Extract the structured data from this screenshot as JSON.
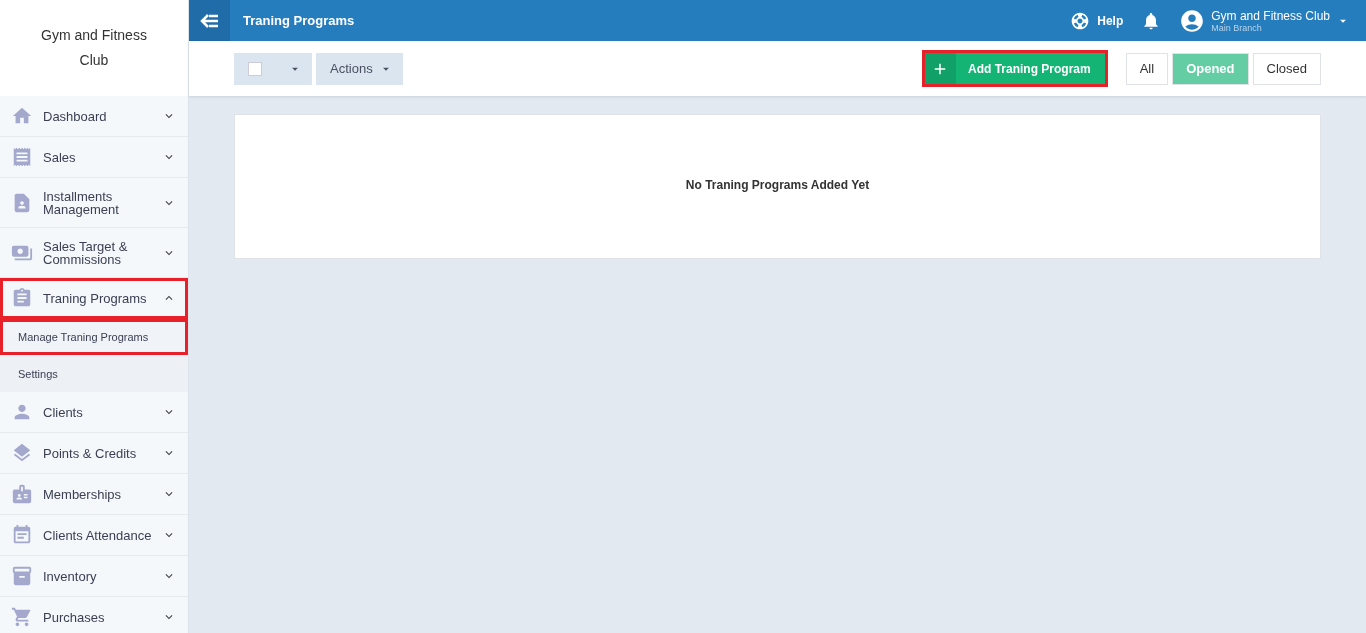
{
  "sidebar": {
    "brand": "Gym and Fitness Club",
    "items": [
      {
        "label": "Dashboard",
        "expanded": false
      },
      {
        "label": "Sales",
        "expanded": false
      },
      {
        "label": "Installments Management",
        "expanded": false
      },
      {
        "label": "Sales Target & Commissions",
        "expanded": false
      },
      {
        "label": "Traning Programs",
        "expanded": true,
        "highlighted": true,
        "children": [
          {
            "label": "Manage Traning Programs",
            "selected": true,
            "highlighted": true
          },
          {
            "label": "Settings",
            "selected": false,
            "highlighted": false
          }
        ]
      },
      {
        "label": "Clients",
        "expanded": false
      },
      {
        "label": "Points & Credits",
        "expanded": false
      },
      {
        "label": "Memberships",
        "expanded": false
      },
      {
        "label": "Clients Attendance",
        "expanded": false
      },
      {
        "label": "Inventory",
        "expanded": false
      },
      {
        "label": "Purchases",
        "expanded": false
      }
    ]
  },
  "header": {
    "title": "Traning Programs",
    "help": "Help",
    "account": {
      "name": "Gym and Fitness Club",
      "branch": "Main Branch"
    }
  },
  "toolbar": {
    "select_all_checked": false,
    "actions": "Actions",
    "add_button": {
      "label": "Add Traning Program",
      "highlighted": true
    },
    "filters": [
      {
        "label": "All",
        "selected": false
      },
      {
        "label": "Opened",
        "selected": true
      },
      {
        "label": "Closed",
        "selected": false
      }
    ]
  },
  "empty_message": "No Traning Programs Added Yet"
}
